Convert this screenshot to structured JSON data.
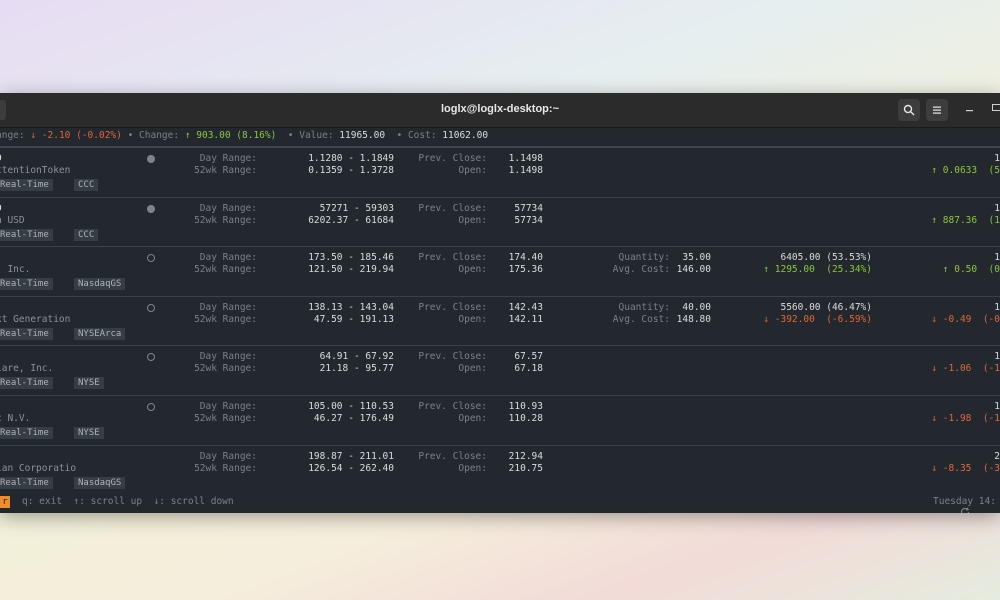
{
  "window": {
    "title": "loglx@loglx-desktop:~"
  },
  "summary": {
    "day_change_label": "ange:",
    "day_change_value": "↓ -2.10 (-0.02%)",
    "change_label": "• Change:",
    "change_value": "↑ 903.00 (8.16%)",
    "value_label": "• Value:",
    "value_value": "11965.00",
    "cost_label": "• Cost:",
    "cost_value": "11062.00"
  },
  "labels": {
    "day_range": "Day Range:",
    "wk52_range": "52wk Range:",
    "prev_close": "Prev. Close:",
    "open": "Open:",
    "quantity": "Quantity:",
    "avg_cost": "Avg. Cost:"
  },
  "rows": [
    {
      "symbol": "D",
      "name": "ttentionToken",
      "badge1": "Real-Time",
      "badge2": "CCC",
      "dot": "filled",
      "day_range": "1.1280 - 1.1849",
      "wk52_range": "0.1359 - 1.3728",
      "prev_close": "1.1498",
      "open": "1.1498",
      "change": "↑ 0.0633  (5",
      "change_dir": "pos",
      "right_top": "1"
    },
    {
      "symbol": "D",
      "name": "n USD",
      "badge1": "Real-Time",
      "badge2": "CCC",
      "dot": "filled",
      "day_range": "57271 - 59303",
      "wk52_range": "6202.37 - 61684",
      "prev_close": "57734",
      "open": "57734",
      "change": "↑ 887.36  (1",
      "change_dir": "pos",
      "right_top": "1"
    },
    {
      "symbol": "",
      "name": ", Inc.",
      "badge1": "Real-Time",
      "badge2": "NasdaqGS",
      "dot": "open",
      "day_range": "173.50 - 185.46",
      "wk52_range": "121.50 - 219.94",
      "prev_close": "174.40",
      "open": "175.36",
      "quantity": "35.00",
      "avg_cost": "146.00",
      "value": "6405.00 (53.53%)",
      "gain": "↑ 1295.00  (25.34%)",
      "gain_dir": "pos",
      "change": "↑ 0.50  (0",
      "change_dir": "pos",
      "right_top": "1"
    },
    {
      "symbol": "",
      "name": "xt Generation",
      "badge1": "Real-Time",
      "badge2": "NYSEArca",
      "dot": "open",
      "day_range": "138.13 - 143.04",
      "wk52_range": "47.59 - 191.13",
      "prev_close": "142.43",
      "open": "142.11",
      "quantity": "40.00",
      "avg_cost": "148.80",
      "value": "5560.00 (46.47%)",
      "gain": "↓ -392.00  (-6.59%)",
      "gain_dir": "neg",
      "change": "↓ -0.49  (-0",
      "change_dir": "neg",
      "right_top": "1"
    },
    {
      "symbol": "",
      "name": "lare, Inc.",
      "badge1": "Real-Time",
      "badge2": "NYSE",
      "dot": "open",
      "day_range": "64.91 - 67.92",
      "wk52_range": "21.18 - 95.77",
      "prev_close": "67.57",
      "open": "67.18",
      "change": "↓ -1.06  (-1",
      "change_dir": "neg",
      "right_top": "1"
    },
    {
      "symbol": "",
      "name": "c N.V.",
      "badge1": "Real-Time",
      "badge2": "NYSE",
      "dot": "open",
      "day_range": "105.00 - 110.53",
      "wk52_range": "46.27 - 176.49",
      "prev_close": "110.93",
      "open": "110.28",
      "change": "↓ -1.98  (-1",
      "change_dir": "neg",
      "right_top": "1"
    },
    {
      "symbol": "",
      "name": "lan Corporatio",
      "badge1": "Real-Time",
      "badge2": "NasdaqGS",
      "dot": "none",
      "day_range": "198.87 - 211.01",
      "wk52_range": "126.54 - 262.40",
      "prev_close": "212.94",
      "open": "210.75",
      "change": "↓ -8.35  (-3",
      "change_dir": "neg",
      "right_top": "2"
    }
  ],
  "footer": {
    "key_r": "r",
    "help": "q: exit  ↑: scroll up  ↓: scroll down",
    "refresh_icon": "refresh-icon",
    "datetime": "Tuesday 14:"
  },
  "colors": {
    "negative": "#e0663a",
    "positive": "#8cc63f",
    "background": "#22282d",
    "accent": "#f08c2a"
  }
}
